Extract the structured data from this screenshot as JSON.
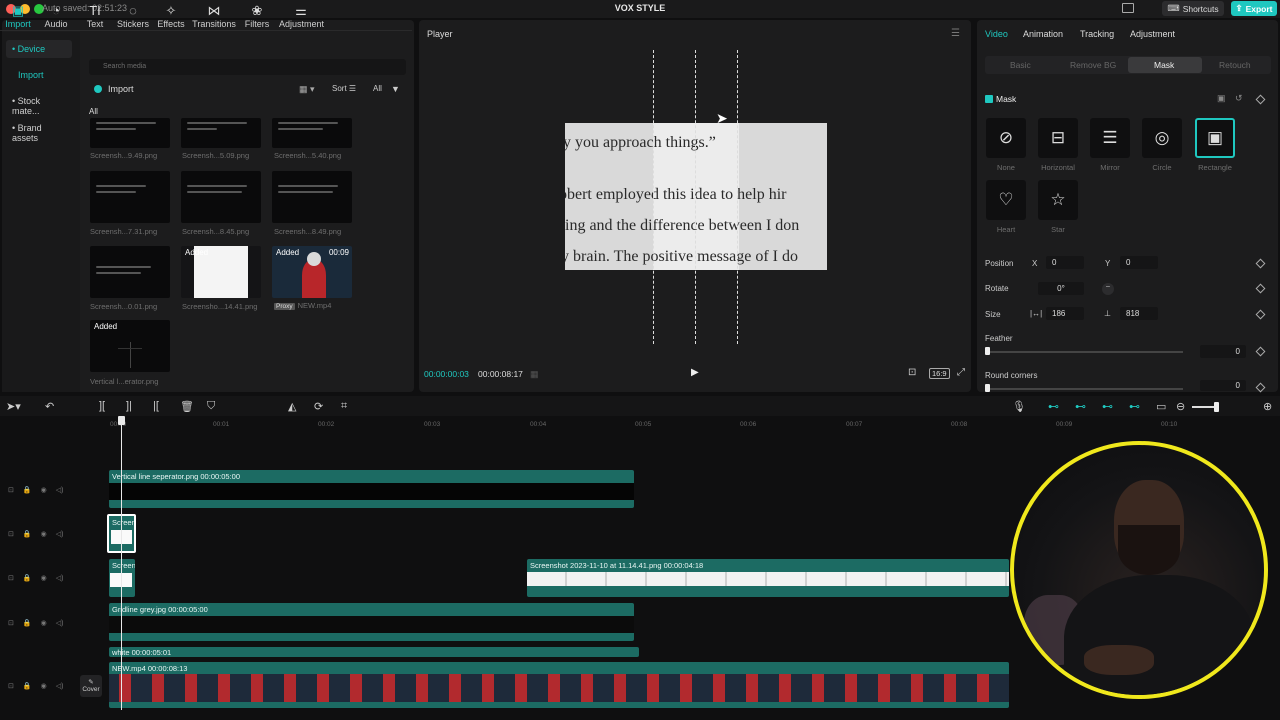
{
  "titlebar": {
    "autosave": "Auto saved: 02:51:23",
    "title": "VOX STYLE",
    "shortcuts": "Shortcuts",
    "export": "Export"
  },
  "media_toolbar": [
    {
      "label": "Import",
      "icon": "▣"
    },
    {
      "label": "Audio",
      "icon": "◔"
    },
    {
      "label": "Text",
      "icon": "TI"
    },
    {
      "label": "Stickers",
      "icon": "◌"
    },
    {
      "label": "Effects",
      "icon": "✧"
    },
    {
      "label": "Transitions",
      "icon": "⋈"
    },
    {
      "label": "Filters",
      "icon": "❀"
    },
    {
      "label": "Adjustment",
      "icon": "⚌"
    }
  ],
  "left_nav": {
    "device": "• Device",
    "import": "Import",
    "stock": "• Stock mate...",
    "brand": "• Brand assets"
  },
  "media": {
    "search_placeholder": "Search media",
    "import_label": "Import",
    "sort": "Sort",
    "all": "All",
    "all_label": "All",
    "items": [
      {
        "caption": "Screensh...9.49.png"
      },
      {
        "caption": "Screensh...5.09.png"
      },
      {
        "caption": "Screensh...5.40.png"
      },
      {
        "caption": "Screensh...7.31.png"
      },
      {
        "caption": "Screensh...8.45.png"
      },
      {
        "caption": "Screensh...8.49.png"
      },
      {
        "caption": "Screensh...0.01.png"
      },
      {
        "caption": "Screensho...14.41.png",
        "badge": "Added"
      },
      {
        "caption": "NEW.mp4",
        "badge": "Added",
        "duration": "00:09",
        "proxy": "Proxy"
      },
      {
        "caption": "Vertical l...erator.png",
        "badge": "Added"
      }
    ]
  },
  "player": {
    "title": "Player",
    "lines": [
      "y you approach things.”",
      "obert employed this idea to help hir",
      "ning and the difference between I don",
      "y brain. The positive message of I do"
    ],
    "time_current": "00:00:00:03",
    "time_total": "00:00:08:17",
    "ratio": "16:9"
  },
  "props": {
    "tabs": [
      "Video",
      "Animation",
      "Tracking",
      "Adjustment"
    ],
    "subtabs": [
      "Basic",
      "Remove BG",
      "Mask",
      "Retouch"
    ],
    "mask_label": "Mask",
    "masks": [
      {
        "name": "None",
        "icon": "⊘"
      },
      {
        "name": "Horizontal",
        "icon": "⊟"
      },
      {
        "name": "Mirror",
        "icon": "☰"
      },
      {
        "name": "Circle",
        "icon": "◎"
      },
      {
        "name": "Rectangle",
        "icon": "▣"
      },
      {
        "name": "Heart",
        "icon": "♡"
      },
      {
        "name": "Star",
        "icon": "☆"
      }
    ],
    "position_label": "Position",
    "x_label": "X",
    "x_value": "0",
    "y_label": "Y",
    "y_value": "0",
    "rotate_label": "Rotate",
    "rotate_value": "0°",
    "size_label": "Size",
    "width_value": "186",
    "height_value": "818",
    "feather_label": "Feather",
    "feather_value": "0",
    "round_label": "Round corners",
    "round_value": "0"
  },
  "timeline": {
    "ticks": [
      "00:00",
      "00:01",
      "00:02",
      "00:03",
      "00:04",
      "00:05",
      "00:06",
      "00:07",
      "00:08",
      "00:09",
      "00:10"
    ],
    "clips": {
      "c1": "Vertical line seperator.png  00:00:05:00",
      "c2": "Screen",
      "c3": "Screen",
      "c4": "Screenshot 2023-11-10 at 11.14.41.png  00:00:04:18",
      "c5": "Gridline grey.jpg  00:00:05:00",
      "c6": "white  00:00:05:01",
      "c7": "NEW.mp4  00:00:08:13"
    },
    "cover": "Cover"
  }
}
